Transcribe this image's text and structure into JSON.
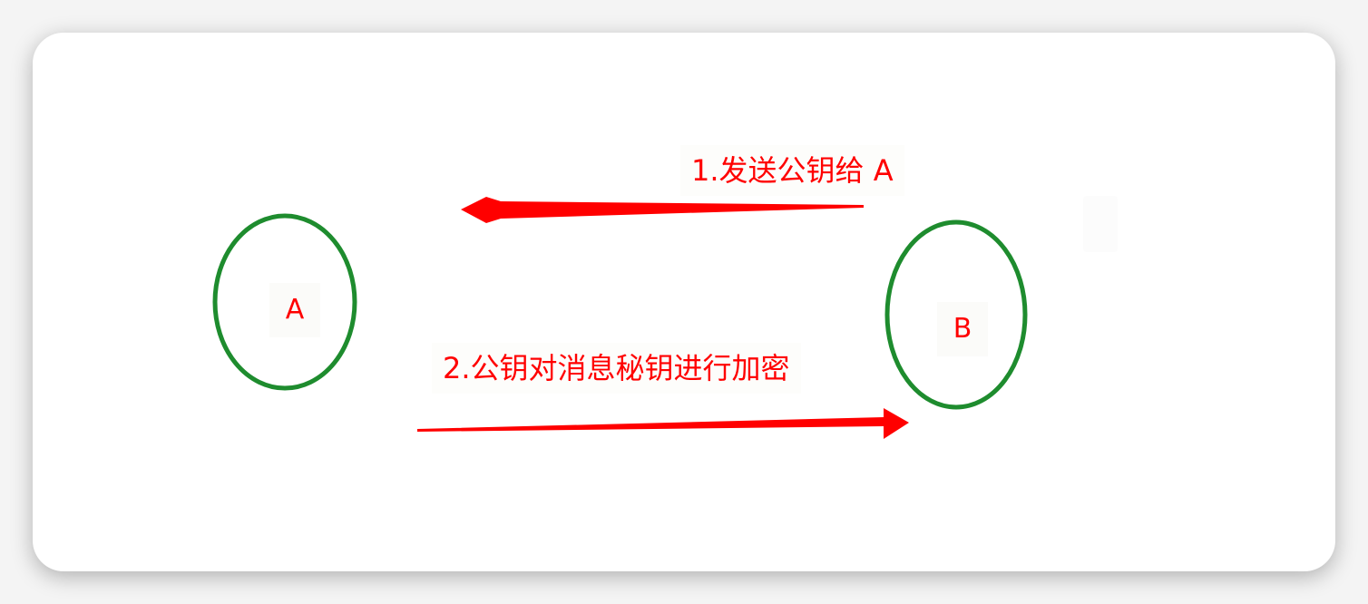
{
  "nodes": {
    "a": {
      "label": "A",
      "stroke_color": "#1e8c2e"
    },
    "b": {
      "label": "B",
      "stroke_color": "#1e8c2e"
    }
  },
  "edges": [
    {
      "id": "step1",
      "label": "1.发送公钥给 A",
      "from": "B",
      "to": "A",
      "color": "#ff0000"
    },
    {
      "id": "step2",
      "label": "2.公钥对消息秘钥进行加密",
      "from": "A",
      "to": "B",
      "color": "#ff0000"
    }
  ]
}
